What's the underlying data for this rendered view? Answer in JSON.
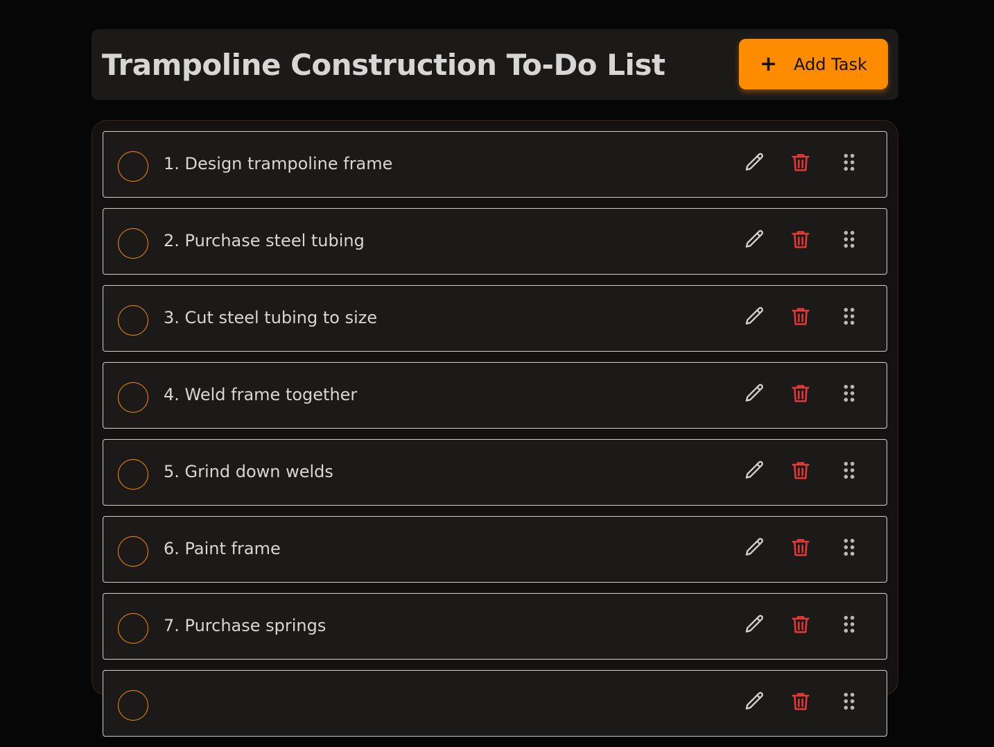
{
  "header": {
    "title": "Trampoline Construction To-Do List",
    "add_button": {
      "icon": "plus-icon",
      "label": "Add Task"
    }
  },
  "colors": {
    "accent": "#ff8c00",
    "delete": "#e53935",
    "background": "#060606",
    "card": "#1c1a19"
  },
  "tasks": [
    {
      "label": "1. Design trampoline frame"
    },
    {
      "label": "2. Purchase steel tubing"
    },
    {
      "label": "3. Cut steel tubing to size"
    },
    {
      "label": "4. Weld frame together"
    },
    {
      "label": "5. Grind down welds"
    },
    {
      "label": "6. Paint frame"
    },
    {
      "label": "7. Purchase springs"
    },
    {
      "label": ""
    }
  ],
  "task_icons": {
    "edit": "pencil-icon",
    "delete": "trash-icon",
    "drag": "drag-handle-icon"
  }
}
